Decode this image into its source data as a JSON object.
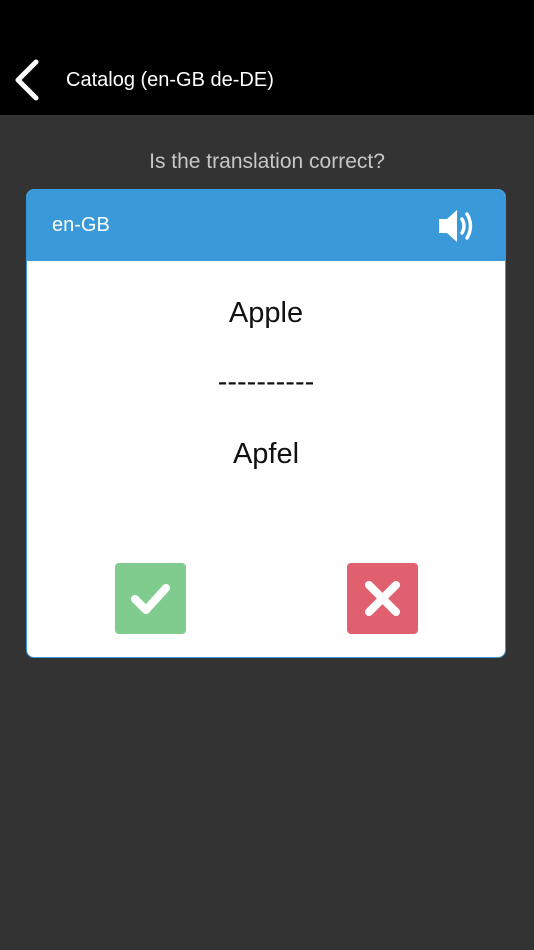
{
  "nav": {
    "title": "Catalog (en-GB de-DE)",
    "back_icon": "chevron-left-icon"
  },
  "prompt": {
    "question": "Is the translation correct?"
  },
  "card": {
    "language": "en-GB",
    "speaker_icon": "speaker-icon",
    "source_word": "Apple",
    "divider": "----------",
    "target_word": "Apfel",
    "correct_icon": "check-icon",
    "wrong_icon": "close-icon"
  },
  "colors": {
    "nav_background": "#000000",
    "page_background": "#333333",
    "card_header": "#3a9ad9",
    "correct_button": "#80cc8e",
    "wrong_button": "#e06070"
  }
}
